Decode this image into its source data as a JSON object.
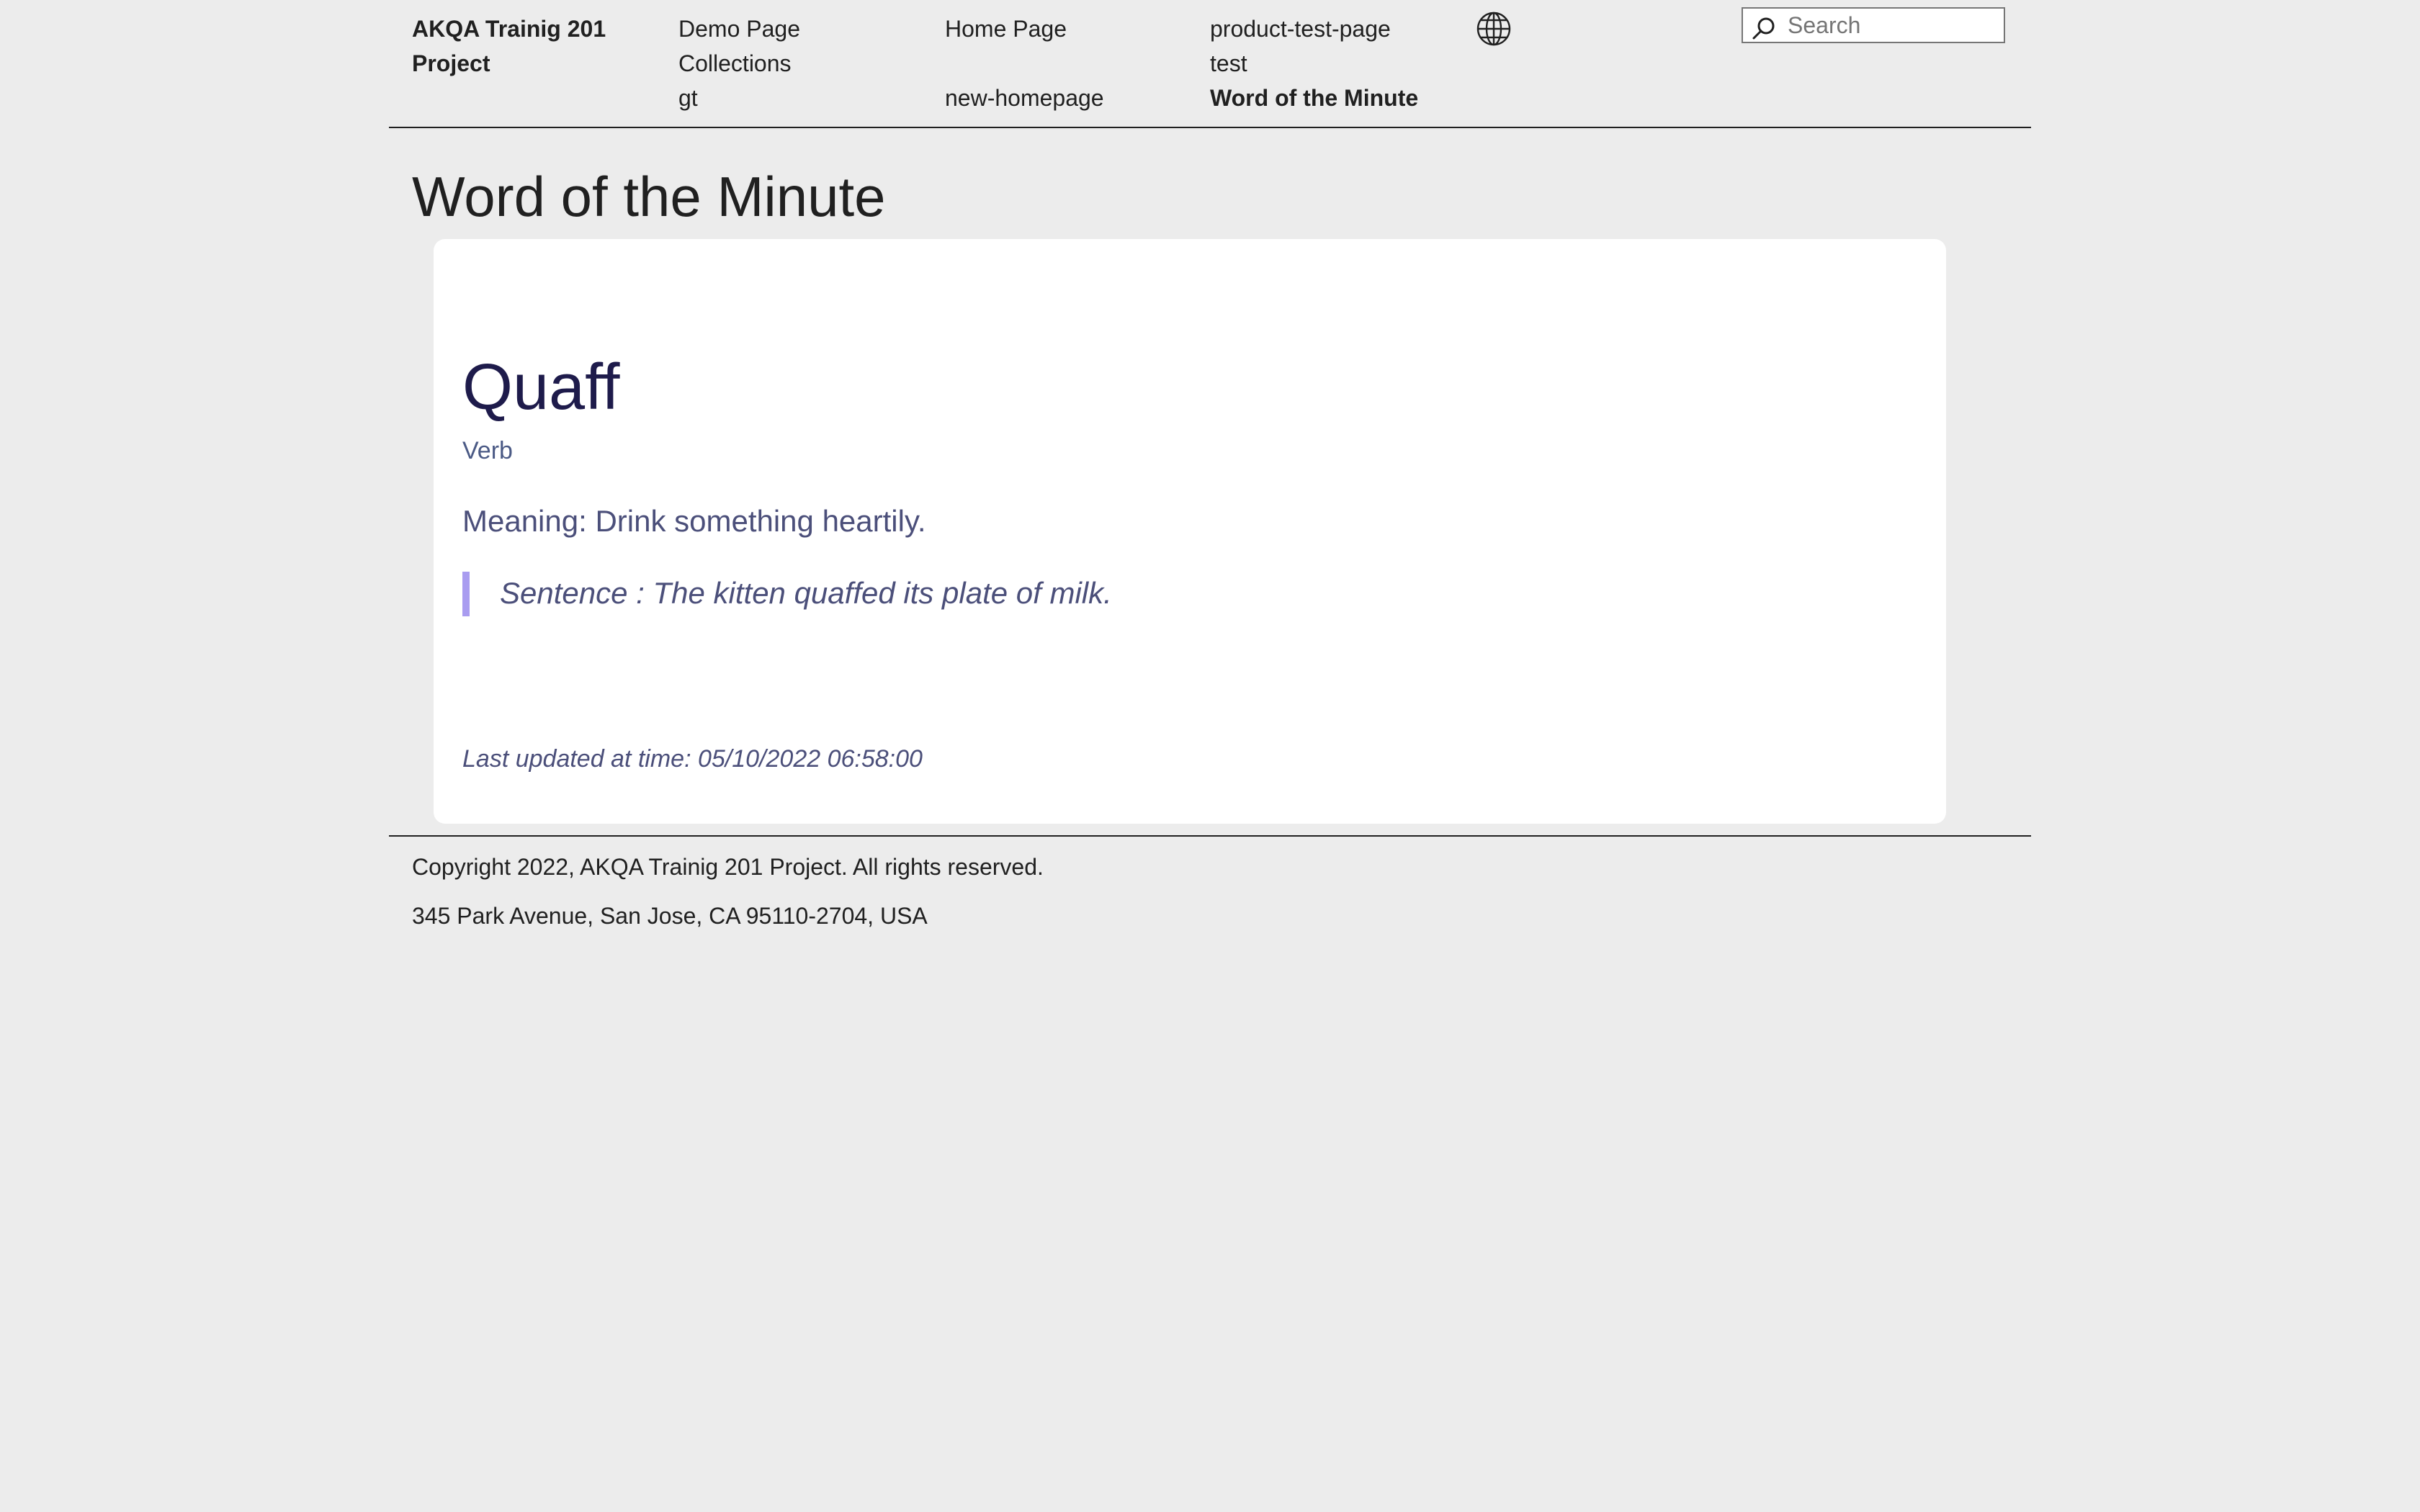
{
  "header": {
    "brand": "AKQA Trainig 201 Project",
    "nav": [
      {
        "label": "Demo Page"
      },
      {
        "label": "Home Page"
      },
      {
        "label": "product-test-page"
      },
      {
        "label": "Collections"
      },
      {
        "label": "test"
      },
      {
        "label": "gt"
      },
      {
        "label": "new-homepage"
      },
      {
        "label": "Word of the Minute",
        "active": true
      }
    ],
    "language_icon": "globe-icon",
    "search": {
      "icon": "search-icon",
      "placeholder": "Search",
      "value": ""
    }
  },
  "main": {
    "title": "Word of the Minute",
    "word_card": {
      "word": "Quaff",
      "part_of_speech": "Verb",
      "meaning": "Meaning: Drink something heartily.",
      "sentence": "Sentence : The kitten quaffed its plate of milk.",
      "last_updated": "Last updated at time: 05/10/2022 06:58:00"
    }
  },
  "footer": {
    "copyright": "Copyright 2022, AKQA Trainig 201 Project. All rights reserved.",
    "address": "345 Park Avenue, San Jose, CA 95110-2704, USA"
  },
  "colors": {
    "background": "#ececec",
    "card": "#ffffff",
    "word": "#1e1b4b",
    "muted_text": "#4b4f7a",
    "quote_bar": "#a99cf0"
  }
}
